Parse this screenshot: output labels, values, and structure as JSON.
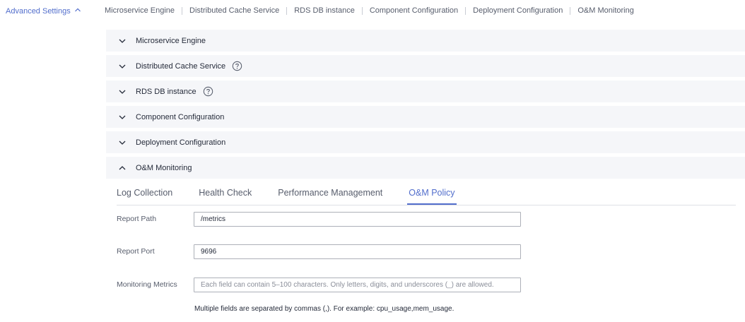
{
  "advanced_settings": {
    "label": "Advanced Settings"
  },
  "anchor_nav": [
    "Microservice Engine",
    "Distributed Cache Service",
    "RDS DB instance",
    "Component Configuration",
    "Deployment Configuration",
    "O&M Monitoring"
  ],
  "panels": [
    {
      "title": "Microservice Engine",
      "expanded": false,
      "help": false
    },
    {
      "title": "Distributed Cache Service",
      "expanded": false,
      "help": true
    },
    {
      "title": "RDS DB instance",
      "expanded": false,
      "help": true
    },
    {
      "title": "Component Configuration",
      "expanded": false,
      "help": false
    },
    {
      "title": "Deployment Configuration",
      "expanded": false,
      "help": false
    },
    {
      "title": "O&M Monitoring",
      "expanded": true,
      "help": false
    }
  ],
  "tabs": [
    {
      "label": "Log Collection",
      "active": false
    },
    {
      "label": "Health Check",
      "active": false
    },
    {
      "label": "Performance Management",
      "active": false
    },
    {
      "label": "O&M Policy",
      "active": true
    }
  ],
  "form": {
    "report_path": {
      "label": "Report Path",
      "value": "/metrics"
    },
    "report_port": {
      "label": "Report Port",
      "value": "9696"
    },
    "monitoring_metrics": {
      "label": "Monitoring Metrics",
      "value": "",
      "placeholder": "Each field can contain 5–100 characters. Only letters, digits, and underscores (_) are allowed.",
      "hint": "Multiple fields are separated by commas (,). For example: cpu_usage,mem_usage."
    }
  },
  "colors": {
    "accent": "#526ecc",
    "panel_bg": "#f5f6f9",
    "text": "#252b3a",
    "muted": "#575d6c"
  }
}
